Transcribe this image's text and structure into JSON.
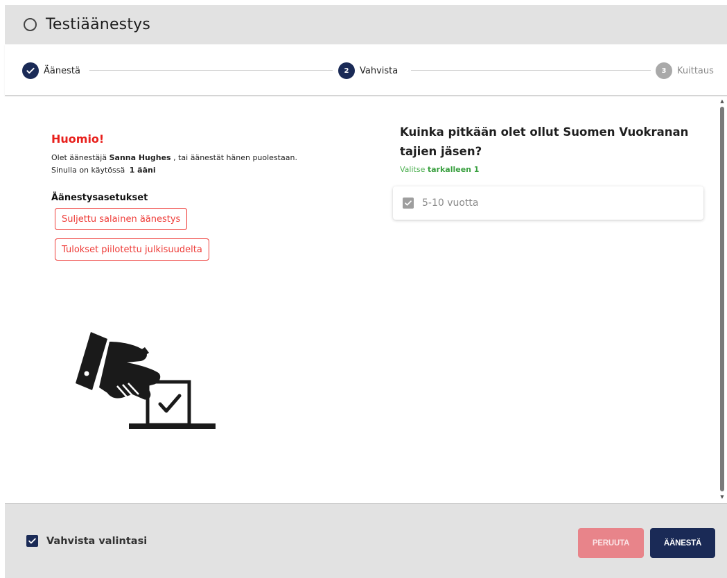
{
  "header": {
    "title": "Testiäänestys"
  },
  "stepper": {
    "steps": [
      {
        "number": "1",
        "label": "Äänestä",
        "state": "done"
      },
      {
        "number": "2",
        "label": "Vahvista",
        "state": "active"
      },
      {
        "number": "3",
        "label": "Kuittaus",
        "state": "inactive"
      }
    ]
  },
  "notice": {
    "title": "Huomio!",
    "voter_prefix": "Olet äänestäjä",
    "voter_name": "Sanna Hughes",
    "voter_suffix": ", tai äänestät hänen puolestaan.",
    "votes_prefix": "Sinulla on käytössä",
    "votes_value": "1 ääni"
  },
  "settings": {
    "title": "Äänestysasetukset",
    "badges": [
      "Suljettu salainen äänestys",
      "Tulokset piilotettu julkisuudelta"
    ]
  },
  "question": {
    "text": "Kuinka pitkään olet ollut Suomen Vuokranantajien jäsen?",
    "line1": "Kuinka pitkään olet ollut Suomen Vuokranan",
    "line2": "tajien jäsen?",
    "hint_prefix": "Valitse",
    "hint_value": "tarkalleen 1",
    "options": [
      {
        "label": "5-10 vuotta",
        "checked": true
      }
    ]
  },
  "footer": {
    "confirm_label": "Vahvista valintasi",
    "confirm_checked": true,
    "cancel_label": "PERUUTA",
    "vote_label": "ÄÄNESTÄ"
  },
  "colors": {
    "primary": "#1a2a56",
    "warning": "#e8201c",
    "badge": "#ee3a36",
    "hint": "#4caf50",
    "cancel": "#e8848a",
    "background": "#e2e2e2"
  },
  "icons": {
    "header": "radio-circle-icon",
    "step_done": "check-icon",
    "illustration": "ballot-box-hand-icon",
    "option": "checkbox-checked-icon"
  }
}
